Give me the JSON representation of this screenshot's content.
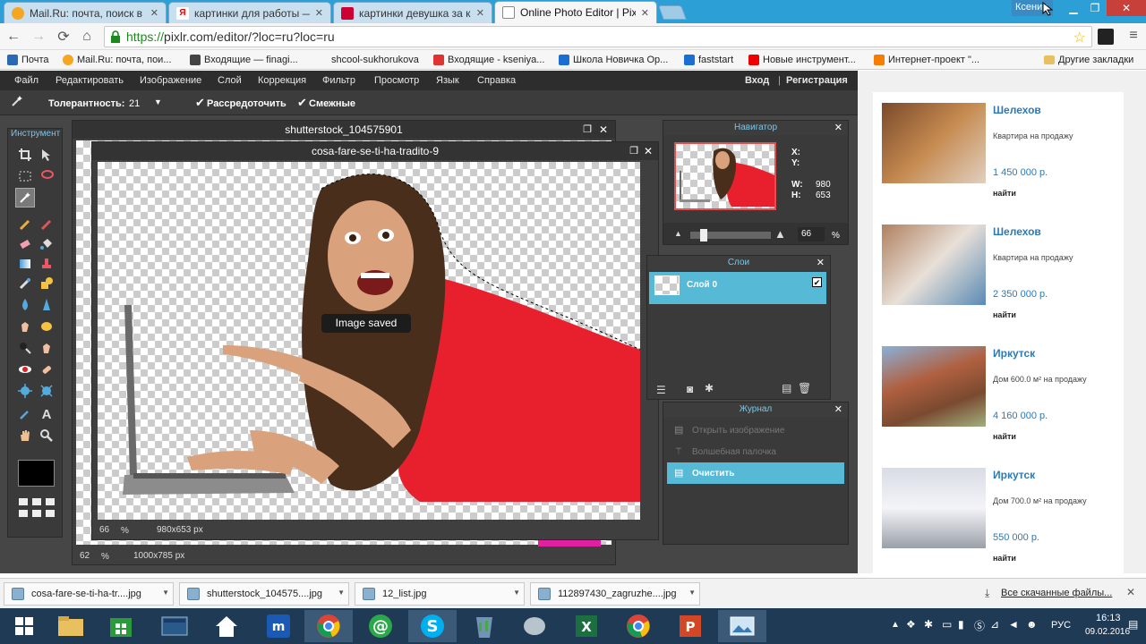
{
  "browser": {
    "tabs": [
      {
        "label": "Mail.Ru: почта, поиск в ин"
      },
      {
        "label": "картинки для работы — Я"
      },
      {
        "label": "картинки девушка за ком"
      },
      {
        "label": "Online Photo Editor | Pixlr"
      }
    ],
    "user": "Ксения",
    "url_secure": "https://",
    "url_rest": "pixlr.com/editor/?loc=ru?loc=ru",
    "bookmarks": [
      {
        "label": "Почта"
      },
      {
        "label": "Mail.Ru: почта, пои..."
      },
      {
        "label": "Входящие — finagi..."
      },
      {
        "label": "shcool-sukhorukova"
      },
      {
        "label": "Входящие - kseniya..."
      },
      {
        "label": "Школа Новичка Ор..."
      },
      {
        "label": "faststart"
      },
      {
        "label": "Новые инструмент..."
      },
      {
        "label": "Интернет-проект \"..."
      }
    ],
    "other_bookmarks": "Другие закладки"
  },
  "editor": {
    "menu": [
      "Файл",
      "Редактировать",
      "Изображение",
      "Слой",
      "Коррекция",
      "Фильтр",
      "Просмотр",
      "Язык",
      "Справка"
    ],
    "login": "Вход",
    "register": "Регистрация",
    "separator": "|",
    "options": {
      "tolerance_label": "Толерантность:",
      "tolerance_value": "21",
      "antialias_label": "Рассредоточить",
      "contiguous_label": "Смежные"
    },
    "tools_title": "Инструмент",
    "doc_back": {
      "title": "shutterstock_104575901",
      "zoom": "62",
      "pct": "%",
      "size": "1000x785 px"
    },
    "doc_front": {
      "title": "cosa-fare-se-ti-ha-tradito-9",
      "zoom": "66",
      "pct": "%",
      "size": "980x653 px"
    },
    "toast": "Image saved",
    "navigator": {
      "title": "Навигатор",
      "x_label": "X:",
      "y_label": "Y:",
      "w_label": "W:",
      "w_value": "980",
      "h_label": "H:",
      "h_value": "653",
      "zoom": "66",
      "pct": "%"
    },
    "layers": {
      "title": "Слои",
      "layer_name": "Слой 0"
    },
    "history": {
      "title": "Журнал",
      "items": [
        {
          "label": "Открыть изображение"
        },
        {
          "label": "Волшебная палочка"
        },
        {
          "label": "Очистить"
        }
      ]
    }
  },
  "ad": {
    "listings": [
      {
        "title": "Шелехов",
        "sub": "Квартира на продажу",
        "price": "1 450 000 р.",
        "find": "найти"
      },
      {
        "title": "Шелехов",
        "sub": "Квартира на продажу",
        "price": "2 350 000 р.",
        "find": "найти"
      },
      {
        "title": "Иркутск",
        "sub": "Дом 600.0 м² на продажу",
        "price": "4 160 000 р.",
        "find": "найти"
      },
      {
        "title": "Иркутск",
        "sub": "Дом 700.0 м² на продажу",
        "price": "550 000 р.",
        "find": "найти"
      }
    ]
  },
  "downloads": {
    "items": [
      {
        "name": "cosa-fare-se-ti-ha-tr....jpg"
      },
      {
        "name": "shutterstock_104575....jpg"
      },
      {
        "name": "12_list.jpg"
      },
      {
        "name": "112897430_zagruzhe....jpg"
      }
    ],
    "all": "Все скачанные файлы..."
  },
  "taskbar": {
    "lang": "РУС",
    "time": "16:13",
    "date": "09.02.2016"
  },
  "colors": {
    "accent": "#56b9d6",
    "chrome_tab_bg": "#2b9fd6",
    "pixlr_bg": "#464646",
    "shirt_red": "#e8202e"
  }
}
